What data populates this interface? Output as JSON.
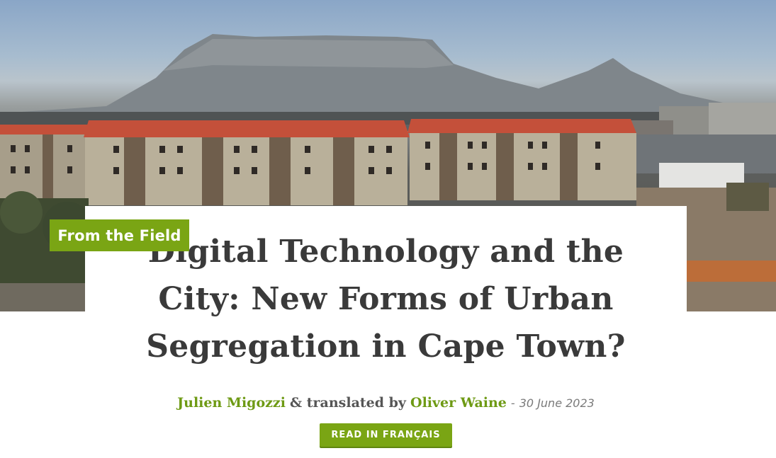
{
  "hero": {
    "description_icon": "landscape-photo",
    "colors": {
      "sky": "#8aa6c7",
      "roof": "#c4503a",
      "wall": "#b9b09a"
    }
  },
  "article": {
    "category": "From the Field",
    "title": "Digital Technology and the City: New Forms of Urban Segregation in Cape Town?",
    "author": "Julien Migozzi",
    "connector": "& translated by",
    "translator": "Oliver Waine",
    "date_separator": "-",
    "date": "30 June 2023",
    "read_in_button": "READ IN FRANÇAIS"
  },
  "theme": {
    "accent": "#7aa514",
    "title_color": "#3a3a3a",
    "link_color": "#6e9a14"
  }
}
